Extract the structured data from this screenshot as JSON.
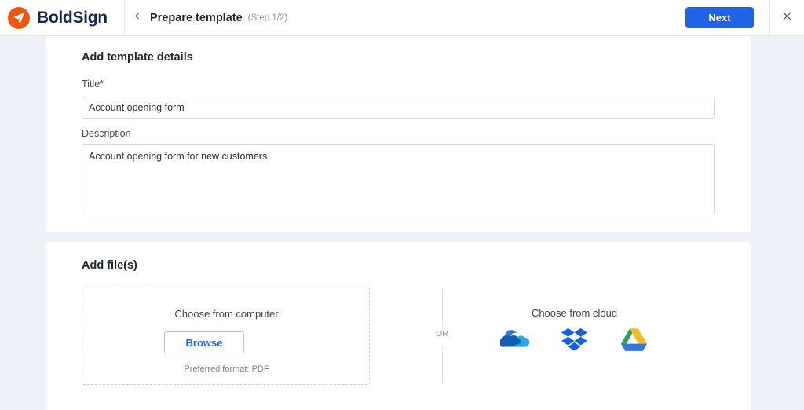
{
  "header": {
    "brand_name": "BoldSign",
    "brand_icon": "boldsign-paper-plane-logo",
    "back_icon": "chevron-left-icon",
    "title": "Prepare template",
    "step": "(Step 1/2)",
    "next_label": "Next",
    "close_icon": "close-icon",
    "accent_color": "#1f64e7",
    "brand_color": "#f2550f"
  },
  "details_card": {
    "title": "Add template details",
    "title_label": "Title*",
    "title_value": "Account opening form",
    "title_placeholder": "Title",
    "description_label": "Description",
    "description_value": "Account opening form for new customers",
    "description_placeholder": "Description"
  },
  "files_card": {
    "title": "Add file(s)",
    "computer": {
      "caption": "Choose from computer",
      "browse_label": "Browse",
      "hint": "Preferred format: PDF"
    },
    "or_label": "OR",
    "cloud": {
      "caption": "Choose from cloud",
      "providers": [
        {
          "name": "onedrive",
          "icon": "onedrive-icon"
        },
        {
          "name": "dropbox",
          "icon": "dropbox-icon"
        },
        {
          "name": "google-drive",
          "icon": "google-drive-icon"
        }
      ]
    }
  }
}
